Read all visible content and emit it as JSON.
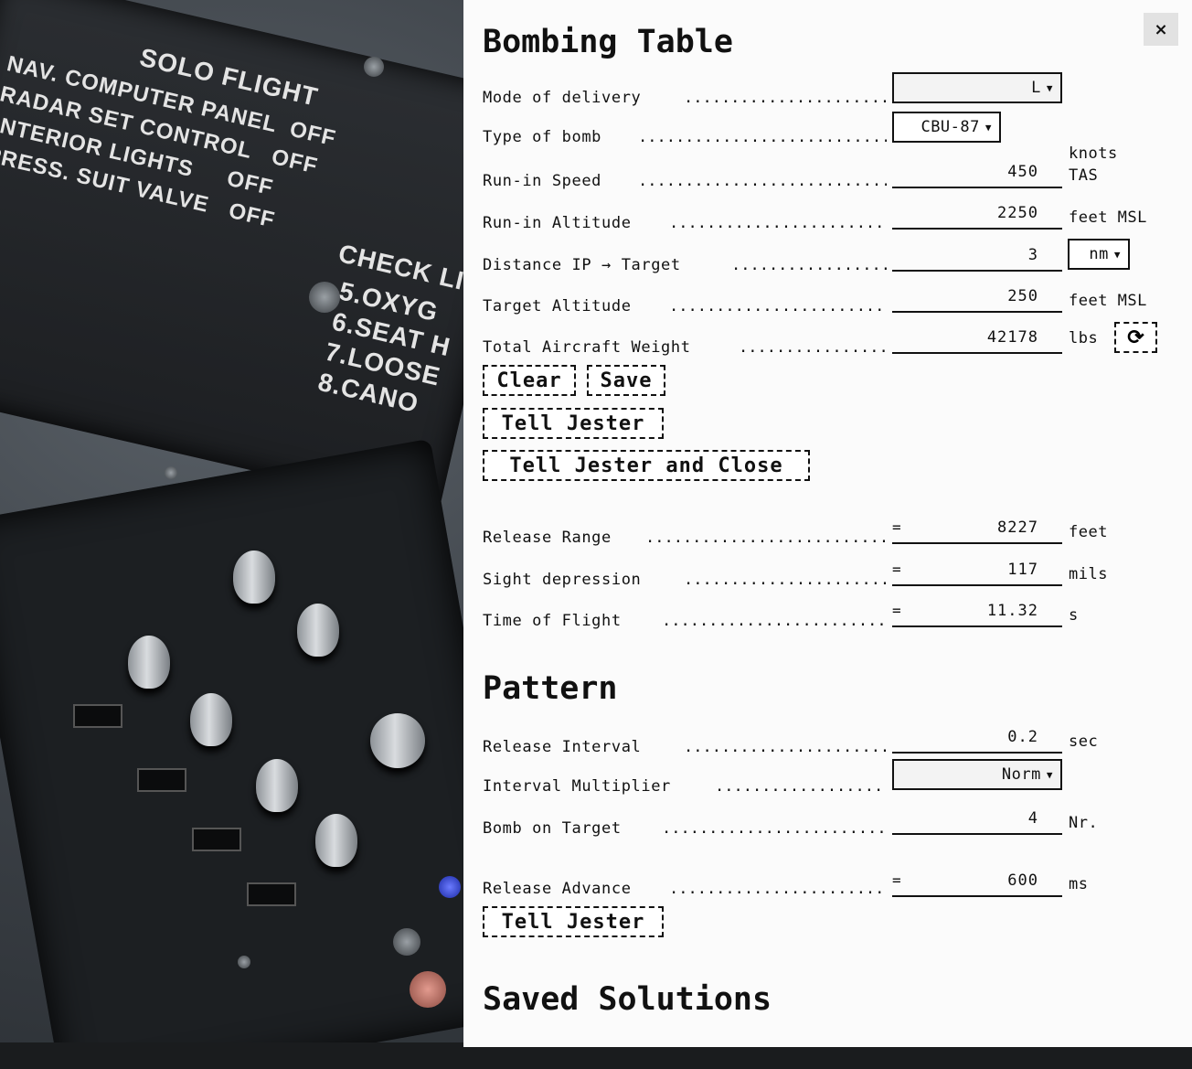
{
  "dialog": {
    "title": "Bombing Table",
    "close_label": "×",
    "inputs": {
      "mode_of_delivery": {
        "label": "Mode of delivery",
        "value": "L"
      },
      "type_of_bomb": {
        "label": "Type of bomb",
        "value": "CBU-87"
      },
      "run_in_speed": {
        "label": "Run-in Speed",
        "value": "450",
        "unit_line1": "knots",
        "unit_line2": "TAS"
      },
      "run_in_altitude": {
        "label": "Run-in Altitude",
        "value": "2250",
        "unit": "feet MSL"
      },
      "distance_ip_target": {
        "label": "Distance IP → Target",
        "value": "3",
        "unit": "nm"
      },
      "target_altitude": {
        "label": "Target Altitude",
        "value": "250",
        "unit": "feet MSL"
      },
      "total_aircraft_weight": {
        "label": "Total Aircraft Weight",
        "value": "42178",
        "unit": "lbs"
      }
    },
    "buttons": {
      "clear": "Clear",
      "save": "Save",
      "tell_jester": "Tell Jester",
      "tell_jester_close": "Tell Jester and Close",
      "pattern_tell_jester": "Tell Jester"
    },
    "results": {
      "release_range": {
        "label": "Release Range",
        "prefix": "=",
        "value": "8227",
        "unit": "feet"
      },
      "sight_depression": {
        "label": "Sight depression",
        "prefix": "=",
        "value": "117",
        "unit": "mils"
      },
      "time_of_flight": {
        "label": "Time of Flight",
        "prefix": "=",
        "value": "11.32",
        "unit": "s"
      }
    },
    "pattern": {
      "title": "Pattern",
      "release_interval": {
        "label": "Release Interval",
        "value": "0.2",
        "unit": "sec"
      },
      "interval_multiplier": {
        "label": "Interval Multiplier",
        "value": "Norm"
      },
      "bomb_on_target": {
        "label": "Bomb on Target",
        "value": "4",
        "unit": "Nr."
      },
      "release_advance": {
        "label": "Release Advance",
        "prefix": "=",
        "value": "600",
        "unit": "ms"
      }
    },
    "saved_title": "Saved Solutions"
  },
  "cockpit": {
    "plate_title": "SOLO FLIGHT",
    "plate_lines": "NAV. COMPUTER PANEL  OFF\nRADAR SET CONTROL   OFF\nINTERIOR LIGHTS     OFF\nPRESS. SUIT VALVE   OFF",
    "check_title": "CHECK LI",
    "check_lines": "5.OXYG\n6.SEAT H\n7.LOOSE\n8.CANO"
  }
}
